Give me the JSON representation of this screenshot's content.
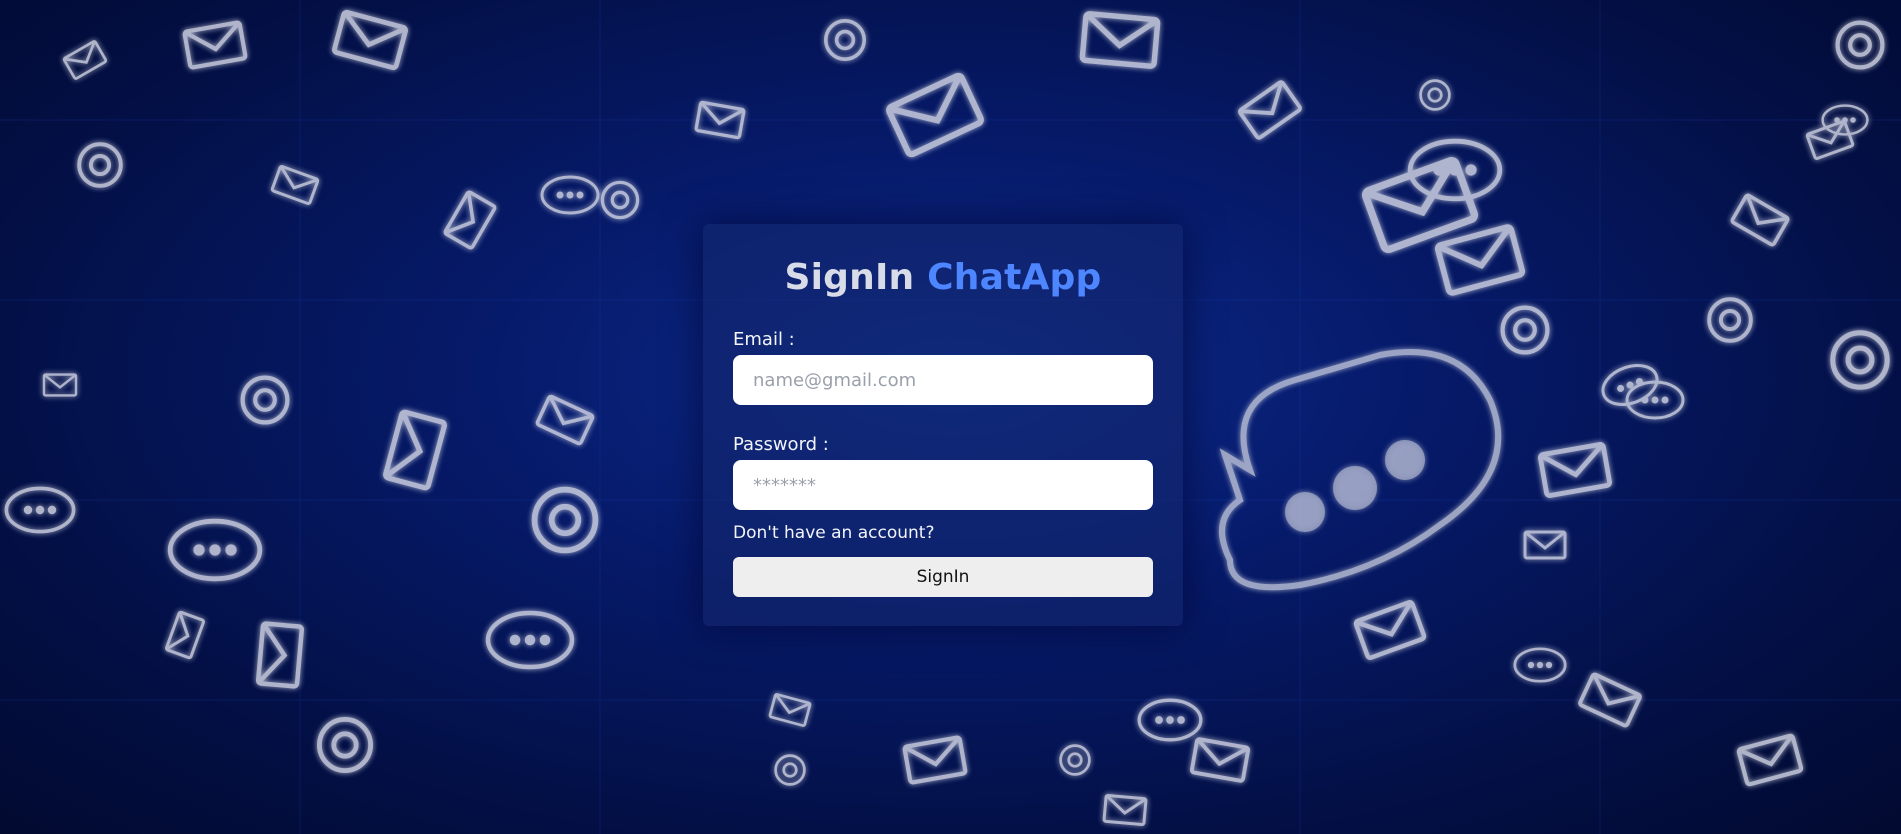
{
  "background": {
    "description_icons": [
      "envelope-icon",
      "at-sign-icon",
      "chat-bubble-icon"
    ],
    "color_base": "#061a6a",
    "color_icon": "#cfd3e3"
  },
  "card": {
    "title_main": "SignIn",
    "title_accent": "ChatApp",
    "accent_color": "#4d86ff",
    "email": {
      "label": "Email :",
      "placeholder": "name@gmail.com",
      "value": ""
    },
    "password": {
      "label": "Password :",
      "placeholder": "*******",
      "value": ""
    },
    "signup_link": "Don't have an account?",
    "submit_label": "SignIn"
  }
}
